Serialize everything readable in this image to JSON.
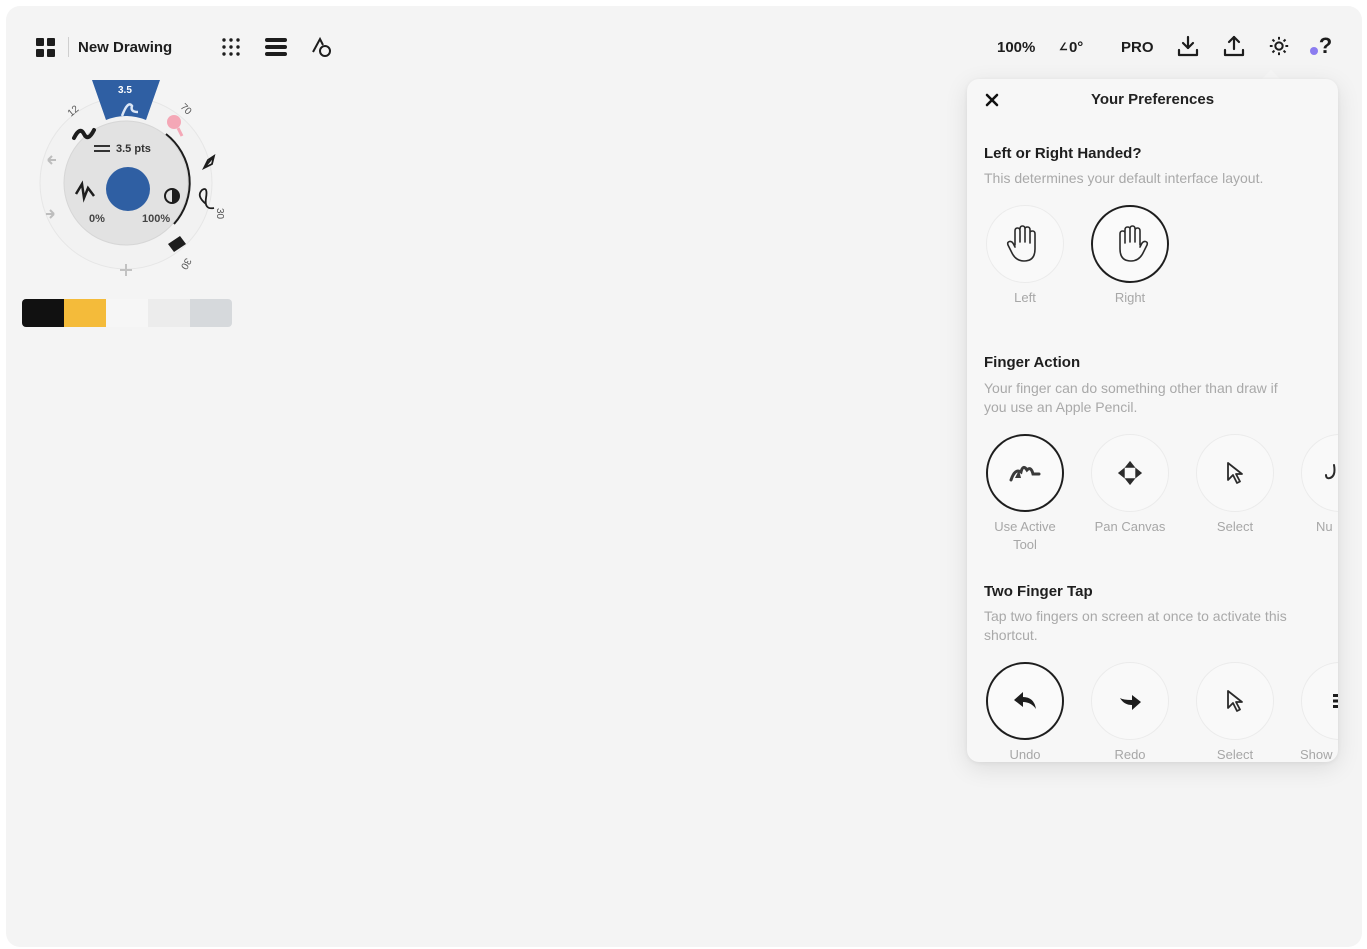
{
  "toolbar": {
    "document_title": "New Drawing",
    "zoom": "100%",
    "rotation": "0°",
    "pro_label": "PRO"
  },
  "brush_wheel": {
    "selected_size": "3.5",
    "size_label": "3.5 pts",
    "left_preset": "12",
    "right_preset": "70",
    "opacity_min": "0%",
    "opacity_max": "100%",
    "size_side_label": "30",
    "eraser_size_label": "30"
  },
  "palette": {
    "colors": [
      "#111111",
      "#f4bb3a",
      "#f6f6f6",
      "#ececec",
      "#d6d9dc"
    ]
  },
  "preferences": {
    "title": "Your Preferences",
    "handed": {
      "title": "Left or Right Handed?",
      "description": "This determines your default interface layout.",
      "options": [
        {
          "label": "Left",
          "icon": "hand-left-icon",
          "selected": false
        },
        {
          "label": "Right",
          "icon": "hand-right-icon",
          "selected": true
        }
      ]
    },
    "finger_action": {
      "title": "Finger Action",
      "description": "Your finger can do something other than draw if you use an Apple Pencil.",
      "options": [
        {
          "label": "Use Active Tool",
          "icon": "brush-stroke-icon",
          "selected": true
        },
        {
          "label": "Pan Canvas",
          "icon": "pan-arrows-icon",
          "selected": false
        },
        {
          "label": "Select",
          "icon": "cursor-icon",
          "selected": false
        },
        {
          "label": "Nu",
          "icon": "nudge-icon",
          "selected": false
        }
      ]
    },
    "two_finger_tap": {
      "title": "Two Finger Tap",
      "description": "Tap two fingers on screen at once to activate this shortcut.",
      "options": [
        {
          "label": "Undo",
          "icon": "undo-arrow-icon",
          "selected": true
        },
        {
          "label": "Redo",
          "icon": "redo-arrow-icon",
          "selected": false
        },
        {
          "label": "Select",
          "icon": "cursor-icon",
          "selected": false
        },
        {
          "label": "Show",
          "icon": "show-icon",
          "selected": false
        }
      ]
    }
  },
  "colors": {
    "accent_blue": "#2f5fa3",
    "pink": "#f4a7b6",
    "notification_dot": "#8b7cf0"
  }
}
